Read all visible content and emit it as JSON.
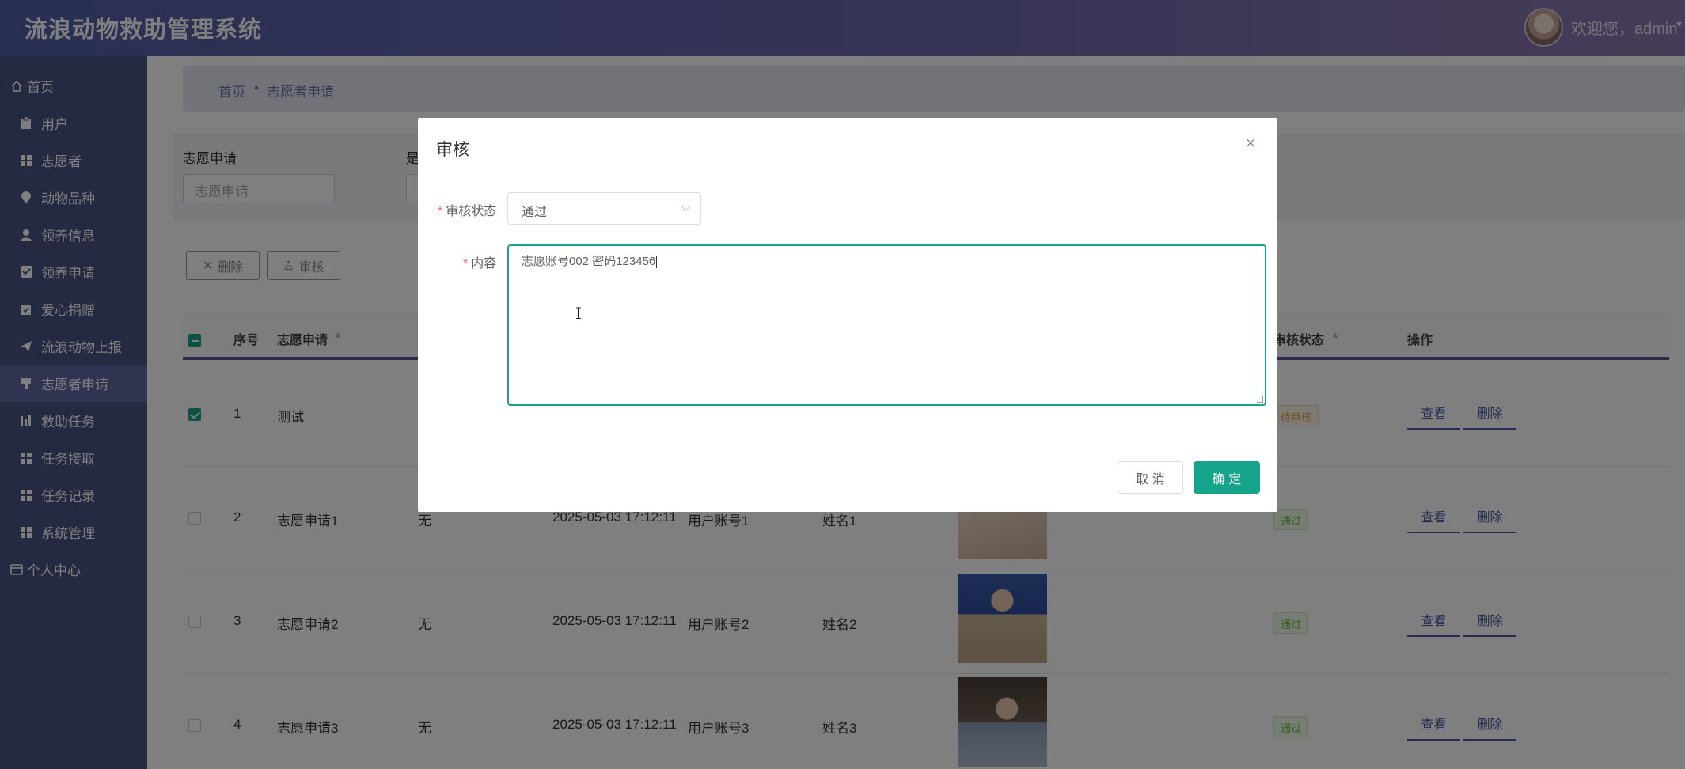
{
  "header": {
    "title": "流浪动物救助管理系统",
    "welcome": "欢迎您，admin",
    "caret": "▾"
  },
  "sidebar": {
    "items": [
      {
        "label": "首页",
        "icon": "home-icon"
      },
      {
        "label": "用户",
        "icon": "clipboard-icon"
      },
      {
        "label": "志愿者",
        "icon": "grid-icon"
      },
      {
        "label": "动物品种",
        "icon": "pin-icon"
      },
      {
        "label": "领养信息",
        "icon": "user-icon"
      },
      {
        "label": "领养申请",
        "icon": "check-square-icon"
      },
      {
        "label": "爱心捐赠",
        "icon": "clipboard-check-icon"
      },
      {
        "label": "流浪动物上报",
        "icon": "send-icon"
      },
      {
        "label": "志愿者申请",
        "icon": "flag-icon"
      },
      {
        "label": "救助任务",
        "icon": "bar-chart-icon"
      },
      {
        "label": "任务接取",
        "icon": "grid-icon"
      },
      {
        "label": "任务记录",
        "icon": "grid-icon"
      },
      {
        "label": "系统管理",
        "icon": "grid-icon"
      },
      {
        "label": "个人中心",
        "icon": "wallet-icon"
      }
    ],
    "active_index": 8
  },
  "breadcrumb": {
    "home": "首页",
    "sep": "•",
    "current": "志愿者申请"
  },
  "search": {
    "label1": "志愿申请",
    "placeholder1": "志愿申请",
    "label2": "是"
  },
  "toolbar": {
    "delete_label": "删除",
    "audit_label": "审核"
  },
  "table": {
    "headers": {
      "index": "序号",
      "apply": "志愿申请",
      "audit_status": "审核状态",
      "ops": "操作"
    },
    "rows": [
      {
        "index": "1",
        "apply": "测试",
        "remark": "",
        "time": "",
        "account": "",
        "name": "",
        "status": "待审核",
        "checked": true
      },
      {
        "index": "2",
        "apply": "志愿申请1",
        "remark": "无",
        "time": "2025-05-03 17:12:11",
        "account": "用户账号1",
        "name": "姓名1",
        "status": "通过",
        "checked": false
      },
      {
        "index": "3",
        "apply": "志愿申请2",
        "remark": "无",
        "time": "2025-05-03 17:12:11",
        "account": "用户账号2",
        "name": "姓名2",
        "status": "通过",
        "checked": false
      },
      {
        "index": "4",
        "apply": "志愿申请3",
        "remark": "无",
        "time": "2025-05-03 17:12:11",
        "account": "用户账号3",
        "name": "姓名3",
        "status": "通过",
        "checked": false
      }
    ],
    "view_label": "查看",
    "delete_label": "删除"
  },
  "dialog": {
    "title": "审核",
    "close": "×",
    "status_label": "审核状态",
    "status_value": "通过",
    "content_label": "内容",
    "content_value": "志愿账号002 密码123456",
    "ibeam": "I",
    "cancel_label": "取 消",
    "ok_label": "确 定"
  },
  "colors": {
    "accent": "#16a58b",
    "sidebar": "#4a5486",
    "header_start": "#5360a8",
    "header_end": "#8f79b0"
  }
}
